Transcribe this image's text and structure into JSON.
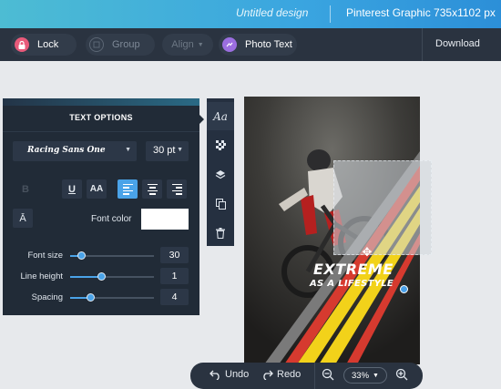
{
  "header": {
    "title": "Untitled design",
    "design_size": "Pinterest Graphic 735x1102 px"
  },
  "toolbar": {
    "lock_label": "Lock",
    "group_label": "Group",
    "align_label": "Align",
    "phototext_label": "Photo Text",
    "download_label": "Download"
  },
  "side_strip": {
    "text_tab_label": "Aa"
  },
  "text_options": {
    "title": "TEXT OPTIONS",
    "font_family": "Racing Sans One",
    "font_size": "30 pt",
    "bold_label": "B",
    "underline_label": "U",
    "case_label": "AA",
    "caps_label": "Ā",
    "font_color_label": "Font color",
    "font_color": "#ffffff",
    "sliders": [
      {
        "label": "Font size",
        "value": "30",
        "fraction": 0.14
      },
      {
        "label": "Line height",
        "value": "1",
        "fraction": 0.38
      },
      {
        "label": "Spacing",
        "value": "4",
        "fraction": 0.24
      }
    ]
  },
  "design": {
    "headline": "EXTREME",
    "subline": "AS A LIFESTYLE"
  },
  "bottom_bar": {
    "undo_label": "Undo",
    "redo_label": "Redo",
    "zoom_value": "33%"
  },
  "colors": {
    "accent": "#4aa3e8",
    "stripe_red": "#d63a2f",
    "stripe_yellow": "#f2d21a",
    "lock": "#e85a7a",
    "phototext": "#9b6ee0"
  }
}
